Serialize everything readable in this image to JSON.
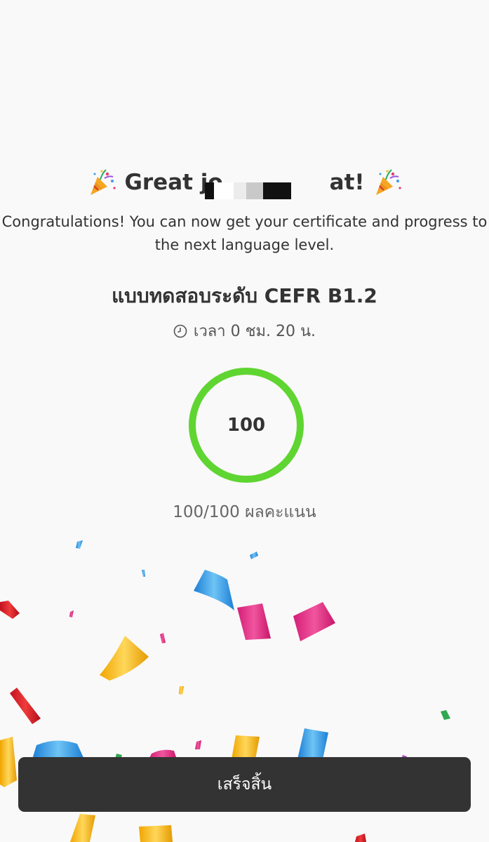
{
  "header": {
    "title_prefix": "Great jo",
    "title_suffix": "at!",
    "subtitle": "Congratulations! You can now get your certificate and progress to the next language level."
  },
  "test": {
    "name": "แบบทดสอบระดับ CEFR B1.2",
    "duration": "เวลา 0 ชม. 20 น."
  },
  "score": {
    "value": "100",
    "points": "100/100 ผลคะแนน",
    "progress_fraction": 1.0,
    "ring_color": "#5fd531"
  },
  "actions": {
    "finish_label": "เสร็จสิ้น"
  },
  "icons": {
    "left": "party-popper-icon",
    "right": "party-popper-icon",
    "clock": "clock-icon"
  }
}
